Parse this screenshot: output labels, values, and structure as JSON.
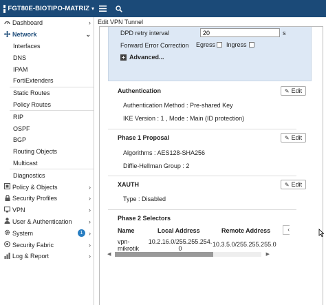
{
  "topbar": {
    "device_name": "FGT80E-BIOTIPO-MATRIZ",
    "caret": "▾",
    "menu_icon": "hamburger-menu-icon",
    "search_icon": "search-icon"
  },
  "sidebar": {
    "items": [
      {
        "label": "Dashboard",
        "icon": "dashboard-icon"
      },
      {
        "label": "Network",
        "icon": "network-icon"
      },
      {
        "label": "Interfaces"
      },
      {
        "label": "DNS"
      },
      {
        "label": "IPAM"
      },
      {
        "label": "FortiExtenders"
      },
      {
        "label": "Static Routes"
      },
      {
        "label": "Policy Routes"
      },
      {
        "label": "RIP"
      },
      {
        "label": "OSPF"
      },
      {
        "label": "BGP"
      },
      {
        "label": "Routing Objects"
      },
      {
        "label": "Multicast"
      },
      {
        "label": "Diagnostics"
      },
      {
        "label": "Policy & Objects",
        "icon": "policy-icon"
      },
      {
        "label": "Security Profiles",
        "icon": "lock-icon"
      },
      {
        "label": "VPN",
        "icon": "monitor-icon"
      },
      {
        "label": "User & Authentication",
        "icon": "user-icon"
      },
      {
        "label": "System",
        "icon": "gear-icon",
        "badge": "1"
      },
      {
        "label": "Security Fabric",
        "icon": "fabric-icon"
      },
      {
        "label": "Log & Report",
        "icon": "chart-icon"
      }
    ]
  },
  "main": {
    "breadcrumb": "Edit VPN Tunnel",
    "dpd_retry_label": "DPD retry interval",
    "dpd_retry_value": "20",
    "dpd_retry_unit": "s",
    "fec_label": "Forward Error Correction",
    "egress_label": "Egress",
    "ingress_label": "Ingress",
    "advanced_label": "Advanced...",
    "edit_label": "Edit",
    "authentication": {
      "title": "Authentication",
      "method": "Authentication Method : Pre-shared Key",
      "ike": "IKE Version : 1 , Mode : Main (ID protection)"
    },
    "phase1": {
      "title": "Phase 1 Proposal",
      "algorithms": "Algorithms : AES128-SHA256",
      "dh_group": "Diffie-Hellman Group : 2"
    },
    "xauth": {
      "title": "XAUTH",
      "type": "Type : Disabled"
    },
    "phase2": {
      "title": "Phase 2 Selectors",
      "columns": [
        "Name",
        "Local Address",
        "Remote Address"
      ],
      "rows": [
        {
          "name": "vpn-\nmikrotik",
          "local": "10.2.16.0/255.255.254.\n0",
          "remote": "10.3.5.0/255.255.255.0"
        }
      ]
    }
  }
}
